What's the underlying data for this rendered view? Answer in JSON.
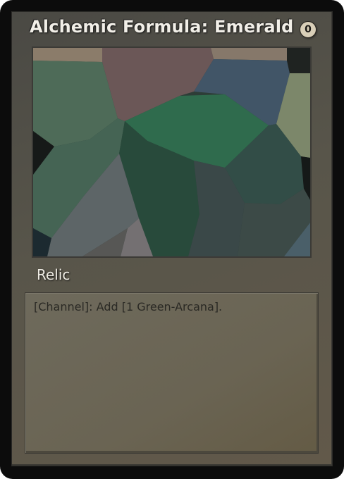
{
  "card": {
    "title": "Alchemic Formula: Emerald",
    "cost": "0",
    "type": "Relic",
    "rules_text": "[Channel]: Add [1 Green-Arcana].",
    "art": {
      "subject": "emerald crystal facets (voronoi mosaic)",
      "palette": [
        "#4d6a58",
        "#6a5656",
        "#3f5566",
        "#2f6a4c",
        "#7a856a",
        "#294a3c",
        "#5c6466",
        "#324c48",
        "#3c4b4a"
      ]
    }
  }
}
